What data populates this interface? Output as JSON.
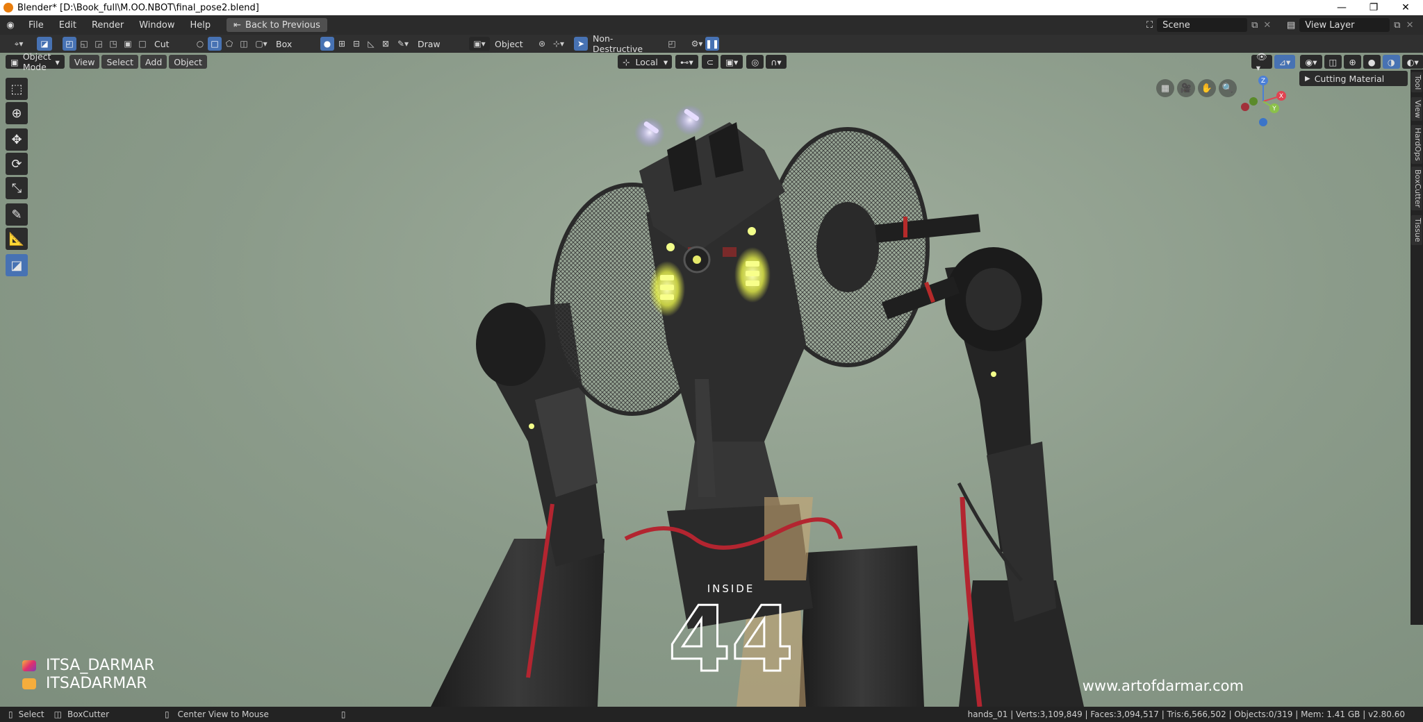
{
  "window": {
    "title": "Blender* [D:\\Book_full\\M.OO.NBOT\\final_pose2.blend]",
    "controls": {
      "minimize": "—",
      "restore": "❐",
      "close": "✕"
    }
  },
  "menubar": {
    "items": [
      "File",
      "Edit",
      "Render",
      "Window",
      "Help"
    ],
    "back_button": "Back to Previous",
    "scene": "Scene",
    "view_layer": "View Layer"
  },
  "tool_header": {
    "mode_label": "Cut",
    "shape_label": "Box",
    "draw_label": "Draw",
    "object_label": "Object",
    "behavior_label": "Non-Destructive"
  },
  "viewport_header": {
    "mode": "Object Mode",
    "menus": [
      "View",
      "Select",
      "Add",
      "Object"
    ],
    "orientation": "Local"
  },
  "sidebar": {
    "tabs": [
      "Tool",
      "View",
      "HardOps",
      "BoxCutter",
      "Tissue"
    ],
    "panel_title": "Cutting Material"
  },
  "gizmo": {
    "z": "Z",
    "y": "Y",
    "x": "X"
  },
  "watermark": {
    "inside": "INSIDE",
    "number": "44",
    "instagram": "ITSA_DARMAR",
    "youtube": "ITSADARMAR",
    "website": "www.artofdarmar.com"
  },
  "status": {
    "select": "Select",
    "boxcutter": "BoxCutter",
    "center_view": "Center View to Mouse",
    "stats": "hands_01 | Verts:3,109,849 | Faces:3,094,517 | Tris:6,566,502 | Objects:0/319 | Mem: 1.41 GB | v2.80.60"
  },
  "colors": {
    "accent": "#4772b3",
    "header": "#303030",
    "viewport_bg": "#8b9b8a",
    "glow_yellow": "#f2ff7a",
    "glow_violet": "#c9b8ff"
  }
}
